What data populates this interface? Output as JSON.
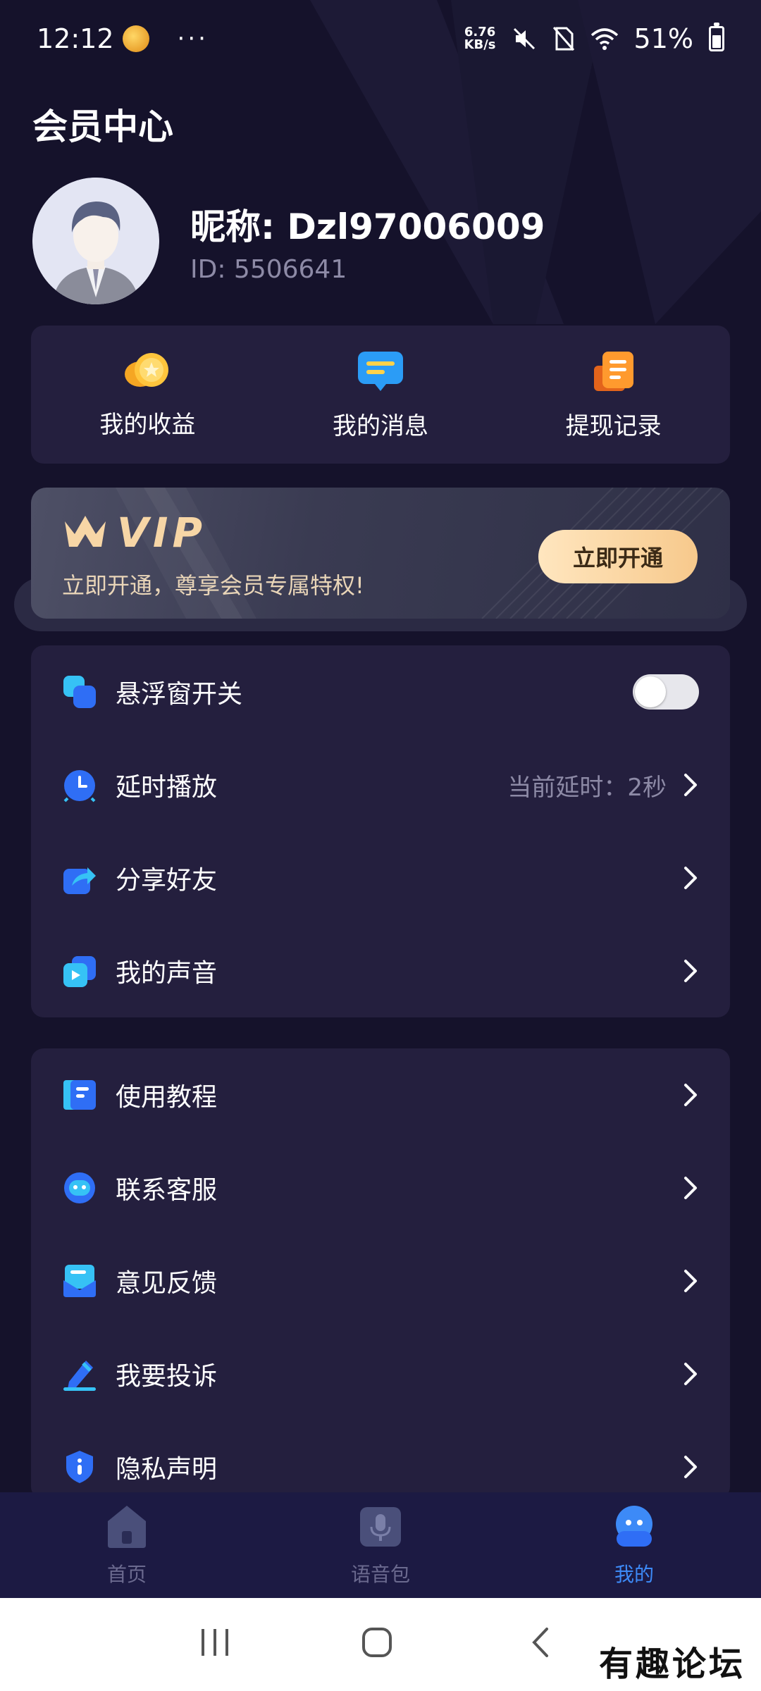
{
  "status": {
    "time": "12:12",
    "dots": "···",
    "net_speed_value": "6.76",
    "net_speed_unit": "KB/s",
    "battery": "51%"
  },
  "page": {
    "title": "会员中心"
  },
  "user": {
    "nickname": "昵称: Dzl97006009",
    "id": "ID: 5506641"
  },
  "quick_actions": [
    {
      "label": "我的收益",
      "icon": "coin-icon"
    },
    {
      "label": "我的消息",
      "icon": "message-icon"
    },
    {
      "label": "提现记录",
      "icon": "withdraw-record-icon"
    }
  ],
  "vip": {
    "title": "VIP",
    "description": "立即开通，尊享会员专属特权!",
    "button": "立即开通"
  },
  "settings": [
    {
      "label": "悬浮窗开关",
      "icon": "floating-window-icon",
      "toggle_on": false
    },
    {
      "label": "延时播放",
      "icon": "delay-clock-icon",
      "value": "当前延时：2秒"
    },
    {
      "label": "分享好友",
      "icon": "share-icon"
    },
    {
      "label": "我的声音",
      "icon": "my-voice-icon"
    }
  ],
  "help": [
    {
      "label": "使用教程",
      "icon": "tutorial-icon"
    },
    {
      "label": "联系客服",
      "icon": "customer-service-icon"
    },
    {
      "label": "意见反馈",
      "icon": "feedback-icon"
    },
    {
      "label": "我要投诉",
      "icon": "complaint-icon"
    },
    {
      "label": "隐私声明",
      "icon": "privacy-icon"
    }
  ],
  "tabs": [
    {
      "label": "首页",
      "icon": "home-icon",
      "active": false
    },
    {
      "label": "语音包",
      "icon": "voice-pack-icon",
      "active": false
    },
    {
      "label": "我的",
      "icon": "profile-icon",
      "active": true
    }
  ],
  "colors": {
    "background": "#15122b",
    "card": "#241f3e",
    "accent_blue": "#3d8af7",
    "vip_gold": "#f7d6a6"
  },
  "watermark": "有趣论坛"
}
